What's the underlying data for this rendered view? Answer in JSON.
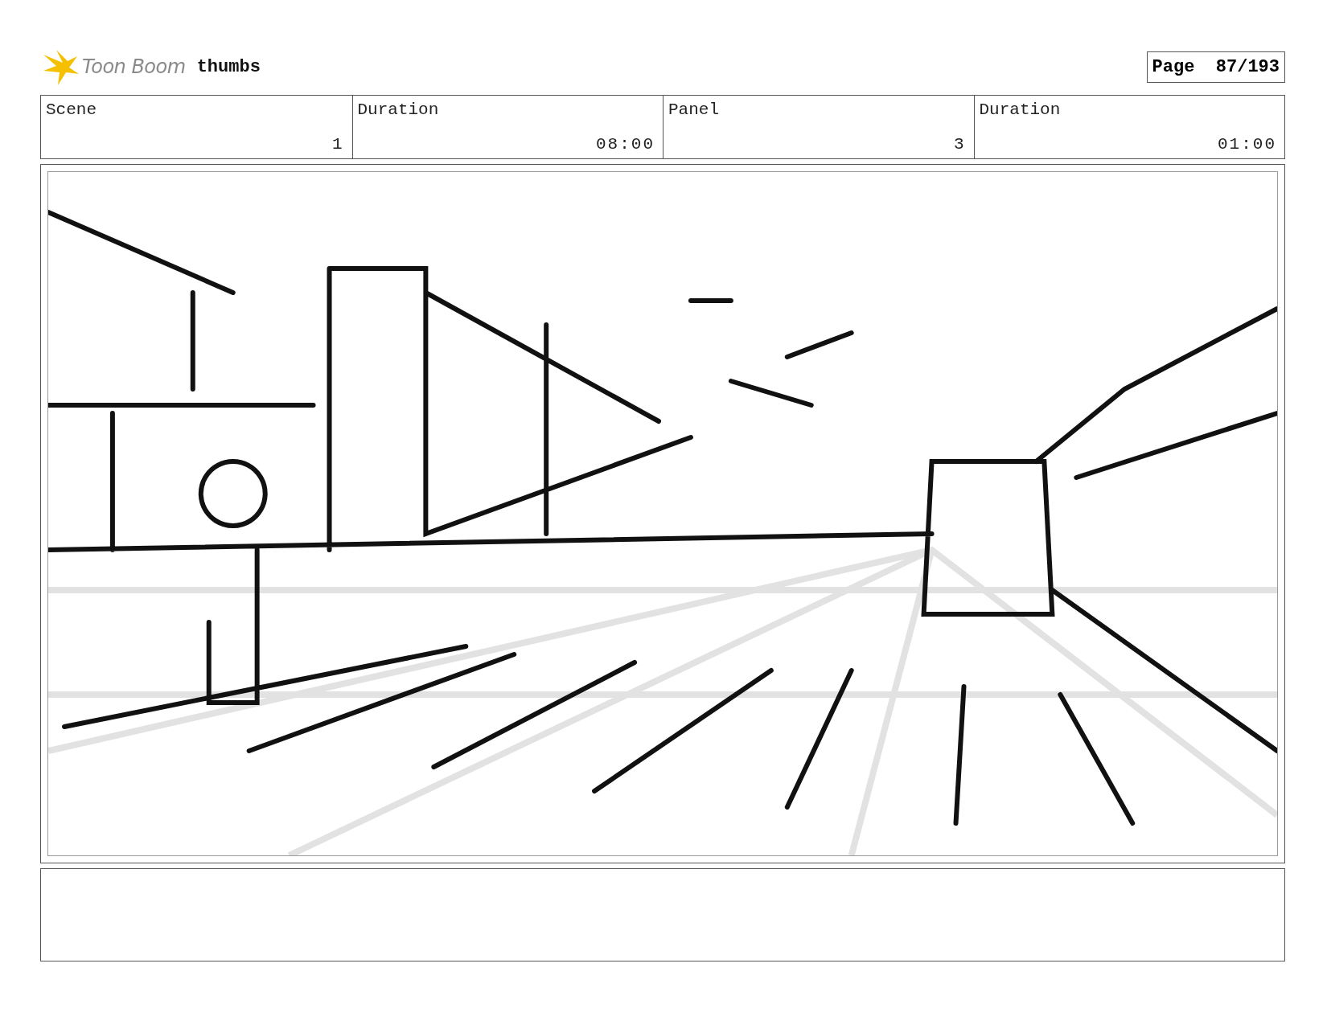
{
  "header": {
    "brand": "Toon Boom",
    "project": "thumbs",
    "page": "Page  87/193"
  },
  "info": [
    {
      "label": "Scene",
      "value": "1"
    },
    {
      "label": "Duration",
      "value": "08:00"
    },
    {
      "label": "Panel",
      "value": "3"
    },
    {
      "label": "Duration",
      "value": "01:00"
    }
  ]
}
